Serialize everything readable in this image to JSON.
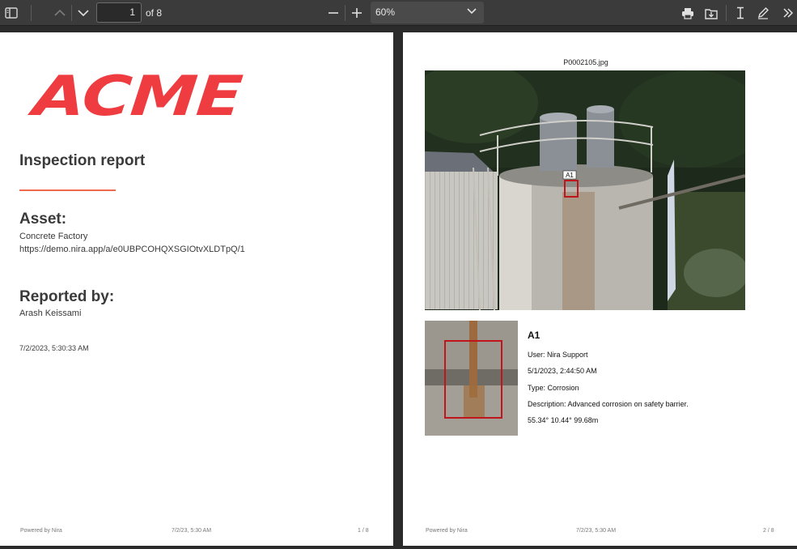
{
  "toolbar": {
    "page_current": "1",
    "page_total": "of 8",
    "zoom": "60%"
  },
  "page1": {
    "logo": "ACME",
    "title": "Inspection report",
    "asset_heading": "Asset:",
    "asset_name": "Concrete Factory",
    "asset_url": "https://demo.nira.app/a/e0UBPCOHQXSGIOtvXLDTpQ/1",
    "reported_heading": "Reported by:",
    "reporter": "Arash Keissami",
    "date": "7/2/2023, 5:30:33 AM",
    "footer_left": "Powered by Nira",
    "footer_center": "7/2/23, 5:30 AM",
    "footer_right": "1 / 8"
  },
  "page2": {
    "filename": "P0002105.jpg",
    "marker_label": "A1",
    "annotation_title": "A1",
    "user": "User: Nira Support",
    "date": "5/1/2023, 2:44:50 AM",
    "type": "Type: Corrosion",
    "description": "Description: Advanced corrosion on safety barrier.",
    "coords": "55.34° 10.44° 99.68m",
    "footer_left": "Powered by Nira",
    "footer_center": "7/2/23, 5:30 AM",
    "footer_right": "2 / 8"
  },
  "colors": {
    "brand": "#ef3c40",
    "accent_rule": "#ef6a4f",
    "toolbar_bg": "#3b3b3b",
    "marker": "#c0161b"
  },
  "icons": [
    "sidebar-toggle-icon",
    "chevron-up-icon",
    "chevron-down-icon",
    "minus-icon",
    "plus-icon",
    "print-icon",
    "download-icon",
    "text-cursor-icon",
    "pen-icon",
    "more-tools-icon"
  ]
}
